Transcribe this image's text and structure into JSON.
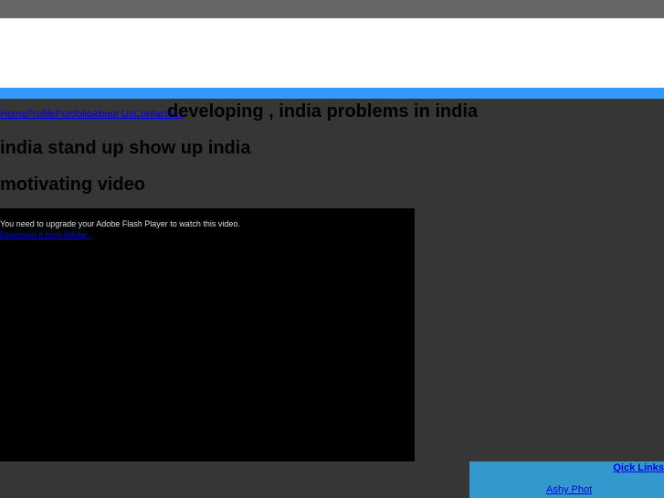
{
  "nav": [
    "Home",
    "Profile",
    "Portfolio",
    "About Us",
    "Contact Us"
  ],
  "headings": [
    "developing , india problems in india",
    "india stand up show up india",
    "motivating video"
  ],
  "video": {
    "message": "You need to upgrade your Adobe Flash Player to watch this video.",
    "download_link": "Download it from Adobe."
  },
  "quick_links": {
    "title": "Qick Links",
    "items": [
      "Ashy Phot"
    ]
  }
}
